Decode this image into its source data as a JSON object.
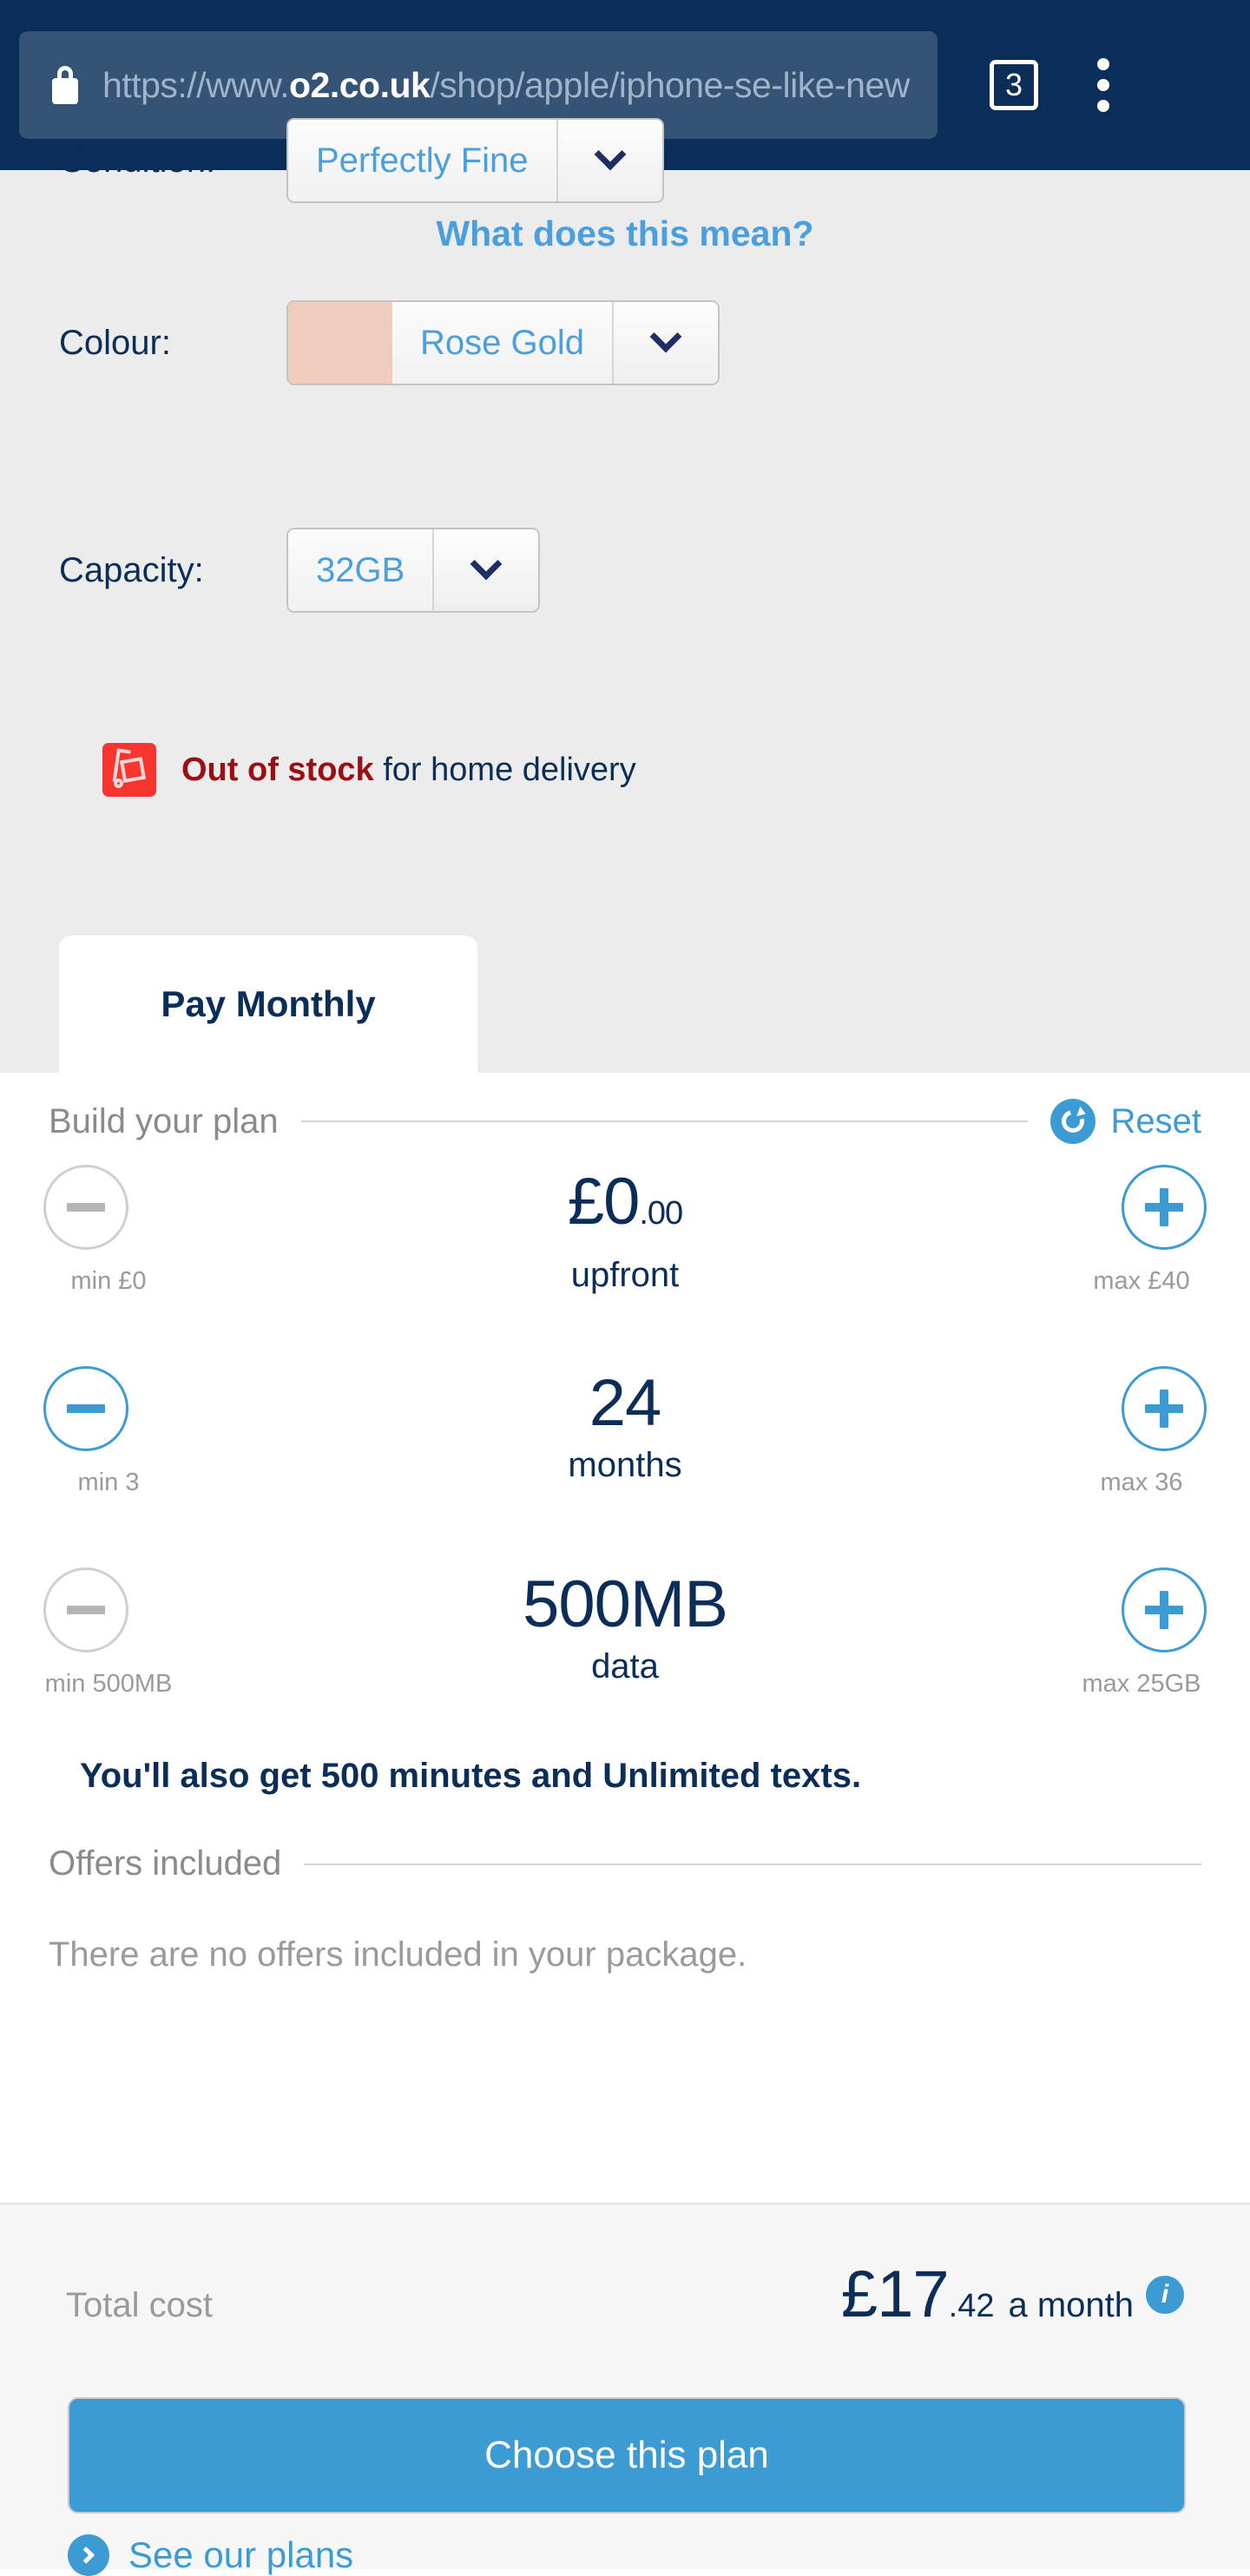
{
  "browser": {
    "lock_icon": "lock-icon",
    "url_prefix": "https://www.",
    "url_host": "o2.co.uk",
    "url_path": "/shop/apple/iphone-se-like-new",
    "tab_count": "3",
    "menu_icon": "overflow-menu-icon"
  },
  "product": {
    "condition": {
      "label": "Condition:",
      "value": "Perfectly Fine"
    },
    "what_does_this_mean": "What does this mean?",
    "colour": {
      "label": "Colour:",
      "value": "Rose Gold",
      "swatch_hex": "#efcdbc"
    },
    "capacity": {
      "label": "Capacity:",
      "value": "32GB"
    },
    "stock": {
      "icon": "delivery-truck-icon",
      "status": "Out of stock",
      "detail": " for home delivery",
      "status_hex": "#9b0f14"
    },
    "tab": "Pay Monthly"
  },
  "plan": {
    "heading": "Build your plan",
    "reset_label": "Reset",
    "reset_icon": "refresh-icon",
    "rows": [
      {
        "name": "upfront",
        "value_main": "£0",
        "value_cents": ".00",
        "unit": "upfront",
        "min_label": "min £0",
        "max_label": "max £40",
        "minus_enabled": false,
        "plus_enabled": true
      },
      {
        "name": "months",
        "value_main": "24",
        "value_cents": "",
        "unit": "months",
        "min_label": "min 3",
        "max_label": "max 36",
        "minus_enabled": true,
        "plus_enabled": true
      },
      {
        "name": "data",
        "value_main": "500MB",
        "value_cents": "",
        "unit": "data",
        "min_label": "min 500MB",
        "max_label": "max 25GB",
        "minus_enabled": false,
        "plus_enabled": true
      }
    ],
    "extras": "You'll also get 500 minutes and Unlimited texts."
  },
  "offers": {
    "heading": "Offers included",
    "empty_text": "There are no offers included in your package."
  },
  "footer": {
    "total_label": "Total cost",
    "total_amount": "£17",
    "total_cents": ".42",
    "total_period": "a month",
    "info_icon": "info-icon",
    "info_glyph": "i",
    "choose_button": "Choose this plan",
    "see_plans_label": "See our plans",
    "see_plans_icon": "chevron-right-circle-icon"
  },
  "colors": {
    "brand_navy": "#0b2e59",
    "brand_blue": "#3d9bd4",
    "link_blue": "#4a9fdc",
    "alert_red": "#f8342e"
  }
}
